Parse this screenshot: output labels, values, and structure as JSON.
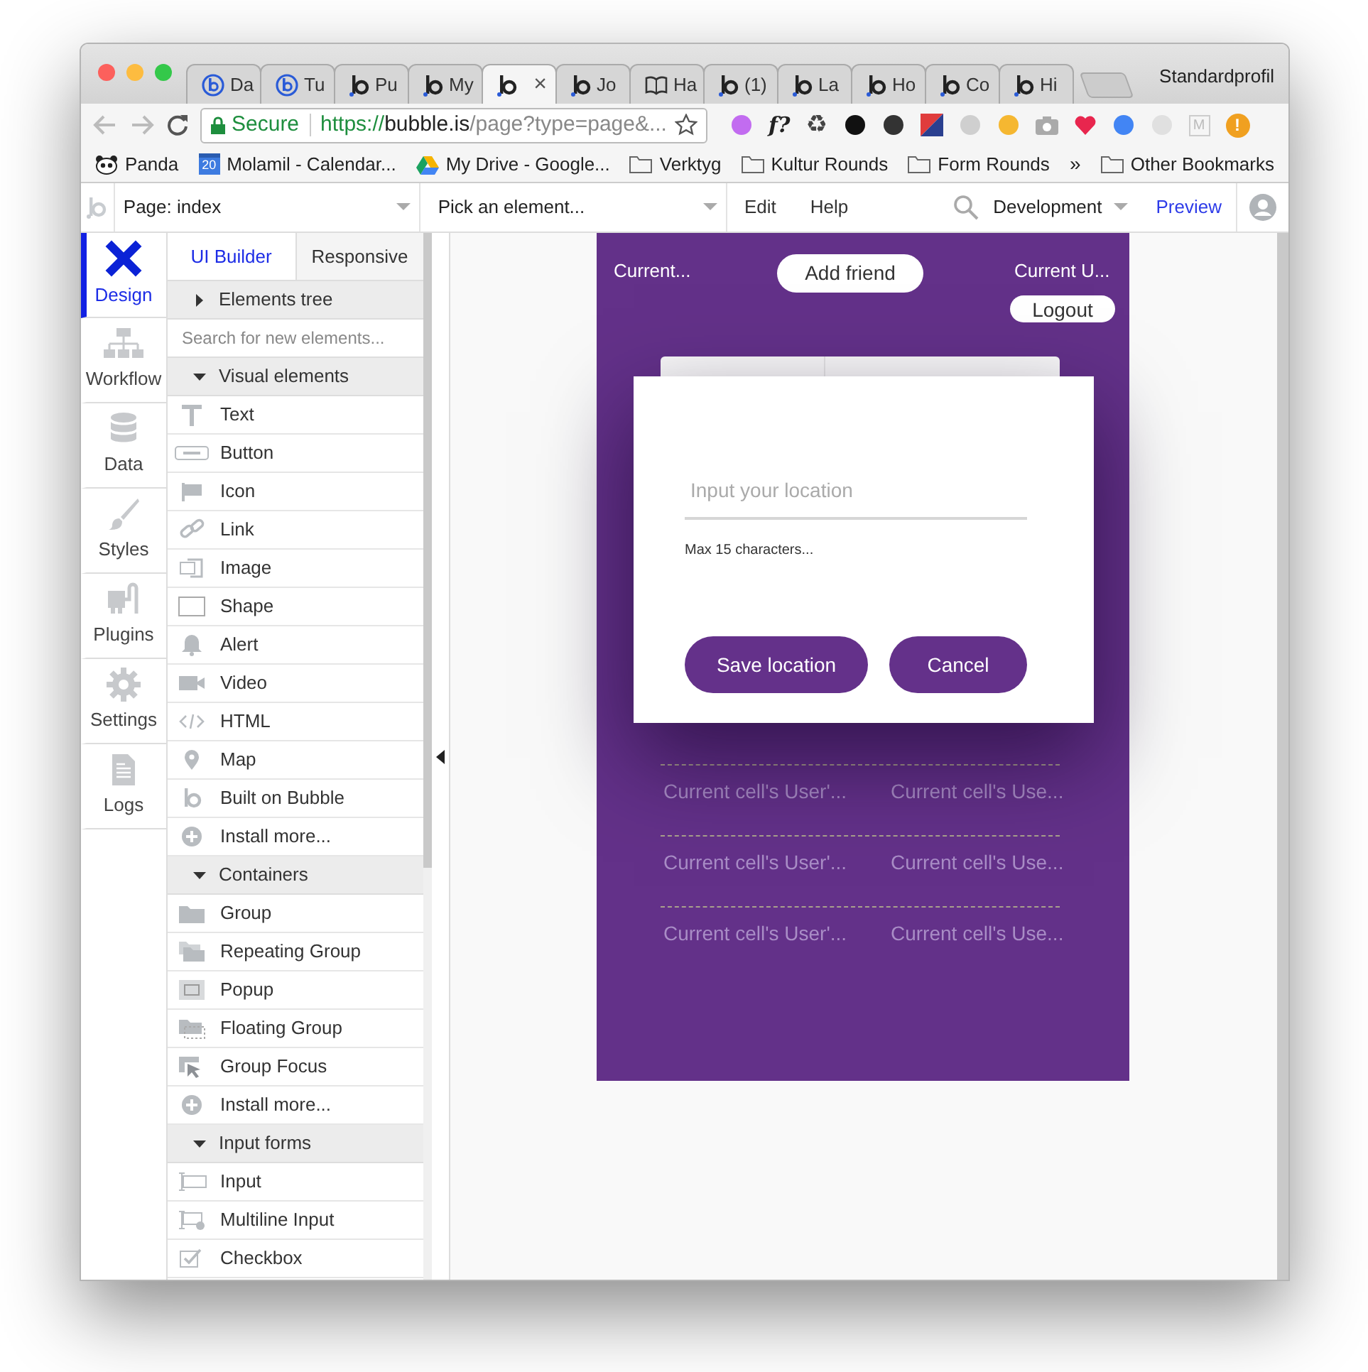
{
  "browser": {
    "tabs": [
      {
        "label": "Da",
        "kind": "bubble-circle",
        "selected": false
      },
      {
        "label": "Tu",
        "kind": "bubble-circle",
        "selected": false
      },
      {
        "label": "Pu",
        "kind": "bubble",
        "selected": false
      },
      {
        "label": "My",
        "kind": "bubble",
        "selected": false
      },
      {
        "kind": "bubble",
        "selected": true,
        "close": "×"
      },
      {
        "label": "Jo",
        "kind": "bubble",
        "selected": false
      },
      {
        "label": "Ha",
        "kind": "book",
        "selected": false
      },
      {
        "label": "(1)",
        "kind": "bubble",
        "selected": false
      },
      {
        "label": "La",
        "kind": "bubble",
        "selected": false
      },
      {
        "label": "Ho",
        "kind": "bubble",
        "selected": false
      },
      {
        "label": "Co",
        "kind": "bubble",
        "selected": false
      },
      {
        "label": "Hi",
        "kind": "bubble",
        "selected": false
      }
    ],
    "profile": "Standardprofil",
    "secure_label": "Secure",
    "url": {
      "scheme": "https://",
      "host": "bubble.is",
      "path": "/page?type=page&..."
    },
    "extensions": [
      {
        "kind": "dot",
        "color": "#c26cf0"
      },
      {
        "kind": "glyph",
        "label": "f?"
      },
      {
        "kind": "glyph",
        "label": "♻"
      },
      {
        "kind": "dot",
        "color": "#111111"
      },
      {
        "kind": "dot",
        "color": "#333333"
      },
      {
        "kind": "flag"
      },
      {
        "kind": "dot",
        "color": "#cfcfcf"
      },
      {
        "kind": "dot",
        "color": "#f5b731"
      },
      {
        "kind": "camera"
      },
      {
        "kind": "heart"
      },
      {
        "kind": "dot",
        "color": "#4285f4"
      },
      {
        "kind": "dot",
        "color": "#e0e0e0"
      },
      {
        "kind": "glyph",
        "label": "M"
      },
      {
        "kind": "badge",
        "color": "#f0a020",
        "label": "!"
      }
    ],
    "bookmarks": [
      {
        "kind": "panda",
        "label": "Panda"
      },
      {
        "kind": "calendar",
        "icon_text": "20",
        "label": "Molamil - Calendar..."
      },
      {
        "kind": "drive",
        "label": "My Drive - Google..."
      },
      {
        "kind": "folder",
        "label": "Verktyg"
      },
      {
        "kind": "folder",
        "label": "Kultur Rounds"
      },
      {
        "kind": "folder",
        "label": "Form Rounds"
      }
    ],
    "bookmarks_overflow": "»",
    "other_bookmarks": "Other Bookmarks"
  },
  "editor_toolbar": {
    "page_select": "Page: index",
    "element_select": "Pick an element...",
    "menus": [
      "Edit",
      "Help"
    ],
    "mode_select": "Development",
    "preview": "Preview"
  },
  "sidebar": {
    "items": [
      {
        "label": "Design",
        "kind": "design",
        "selected": true
      },
      {
        "label": "Workflow",
        "kind": "workflow",
        "selected": false
      },
      {
        "label": "Data",
        "kind": "data",
        "selected": false
      },
      {
        "label": "Styles",
        "kind": "styles",
        "selected": false
      },
      {
        "label": "Plugins",
        "kind": "plugins",
        "selected": false
      },
      {
        "label": "Settings",
        "kind": "settings",
        "selected": false
      },
      {
        "label": "Logs",
        "kind": "logs",
        "selected": false
      }
    ]
  },
  "panel": {
    "tabs": [
      {
        "label": "UI Builder",
        "selected": true
      },
      {
        "label": "Responsive",
        "selected": false
      }
    ],
    "elements_tree": {
      "label": "Elements tree",
      "expanded": false
    },
    "search": {
      "placeholder": "Search for new elements..."
    },
    "categories": [
      {
        "title": "Visual elements",
        "expanded": true,
        "items": [
          {
            "label": "Text",
            "kind": "text"
          },
          {
            "label": "Button",
            "kind": "button"
          },
          {
            "label": "Icon",
            "kind": "flag"
          },
          {
            "label": "Link",
            "kind": "link"
          },
          {
            "label": "Image",
            "kind": "image"
          },
          {
            "label": "Shape",
            "kind": "shape"
          },
          {
            "label": "Alert",
            "kind": "alert"
          },
          {
            "label": "Video",
            "kind": "video"
          },
          {
            "label": "HTML",
            "kind": "html"
          },
          {
            "label": "Map",
            "kind": "map"
          },
          {
            "label": "Built on Bubble",
            "kind": "bubble"
          },
          {
            "label": "Install more...",
            "kind": "plus"
          }
        ]
      },
      {
        "title": "Containers",
        "expanded": true,
        "items": [
          {
            "label": "Group",
            "kind": "folder"
          },
          {
            "label": "Repeating Group",
            "kind": "folders"
          },
          {
            "label": "Popup",
            "kind": "popup"
          },
          {
            "label": "Floating Group",
            "kind": "floating"
          },
          {
            "label": "Group Focus",
            "kind": "focus"
          },
          {
            "label": "Install more...",
            "kind": "plus"
          }
        ]
      },
      {
        "title": "Input forms",
        "expanded": true,
        "items": [
          {
            "label": "Input",
            "kind": "input"
          },
          {
            "label": "Multiline Input",
            "kind": "multiline"
          },
          {
            "label": "Checkbox",
            "kind": "checkbox"
          }
        ]
      }
    ]
  },
  "canvas": {
    "header": {
      "left_text": "Current...",
      "add_button": "Add friend",
      "right_text": "Current U...",
      "logout_button": "Logout"
    },
    "popup": {
      "placeholder": "Input your location",
      "hint": "Max 15 characters...",
      "buttons": [
        {
          "label": "Save location"
        },
        {
          "label": "Cancel"
        }
      ]
    },
    "list_rows": [
      {
        "column_1": "Current cell's User'...",
        "column_2": "Current cell's Use..."
      },
      {
        "column_1": "Current cell's User'...",
        "column_2": "Current cell's Use..."
      },
      {
        "column_1": "Current cell's User'...",
        "column_2": "Current cell's Use..."
      }
    ]
  }
}
